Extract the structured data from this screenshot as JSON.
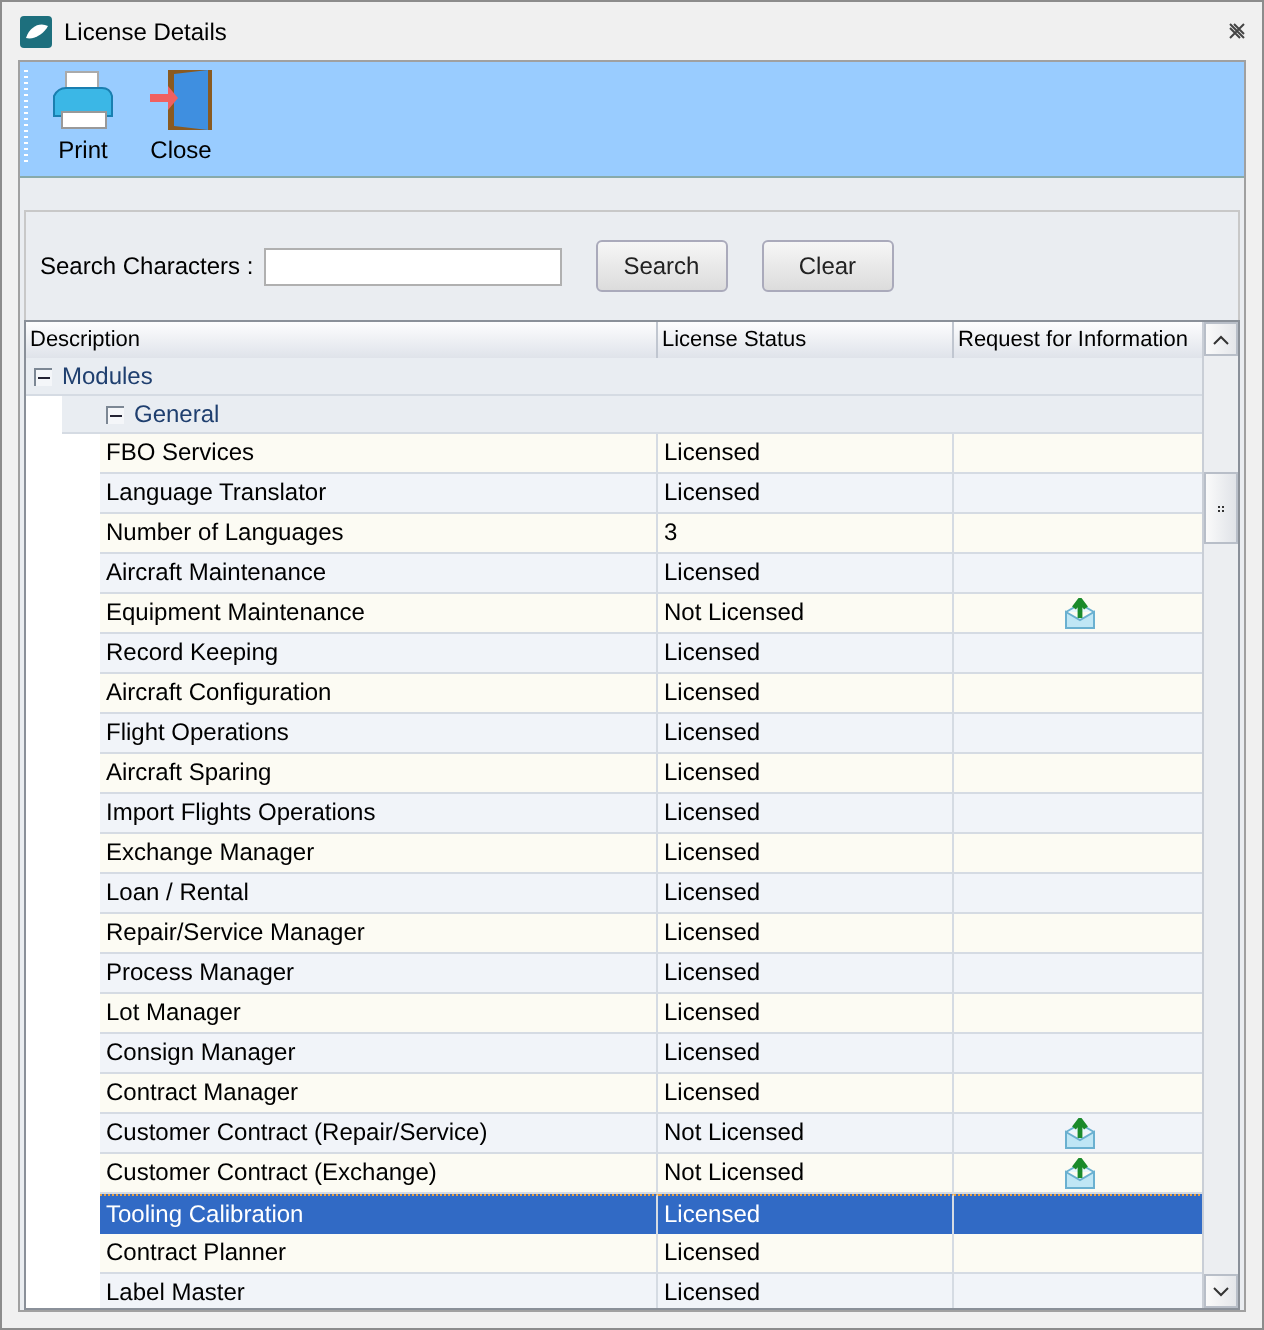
{
  "window": {
    "title": "License Details"
  },
  "toolbar": [
    {
      "label": "Print",
      "kind": "print"
    },
    {
      "label": "Close",
      "kind": "close"
    }
  ],
  "search": {
    "label": "Search Characters :",
    "buttons": [
      "Search",
      "Clear"
    ]
  },
  "grid": {
    "columns": [
      "Description",
      "License Status",
      "Request for Information"
    ],
    "groups": [
      {
        "label": "Modules",
        "expanded": true,
        "children": [
          {
            "label": "General",
            "expanded": true,
            "rows": [
              {
                "description": "FBO Services",
                "status": "Licensed",
                "request": false,
                "selected": false
              },
              {
                "description": "Language Translator",
                "status": "Licensed",
                "request": false,
                "selected": false
              },
              {
                "description": "Number of Languages",
                "status": "3",
                "request": false,
                "selected": false
              },
              {
                "description": "Aircraft Maintenance",
                "status": "Licensed",
                "request": false,
                "selected": false
              },
              {
                "description": "Equipment Maintenance",
                "status": "Not Licensed",
                "request": true,
                "selected": false
              },
              {
                "description": "Record Keeping",
                "status": "Licensed",
                "request": false,
                "selected": false
              },
              {
                "description": "Aircraft Configuration",
                "status": "Licensed",
                "request": false,
                "selected": false
              },
              {
                "description": "Flight Operations",
                "status": "Licensed",
                "request": false,
                "selected": false
              },
              {
                "description": "Aircraft Sparing",
                "status": "Licensed",
                "request": false,
                "selected": false
              },
              {
                "description": "Import Flights Operations",
                "status": "Licensed",
                "request": false,
                "selected": false
              },
              {
                "description": "Exchange Manager",
                "status": "Licensed",
                "request": false,
                "selected": false
              },
              {
                "description": "Loan / Rental",
                "status": "Licensed",
                "request": false,
                "selected": false
              },
              {
                "description": "Repair/Service Manager",
                "status": "Licensed",
                "request": false,
                "selected": false
              },
              {
                "description": "Process Manager",
                "status": "Licensed",
                "request": false,
                "selected": false
              },
              {
                "description": "Lot Manager",
                "status": "Licensed",
                "request": false,
                "selected": false
              },
              {
                "description": "Consign Manager",
                "status": "Licensed",
                "request": false,
                "selected": false
              },
              {
                "description": "Contract Manager",
                "status": "Licensed",
                "request": false,
                "selected": false
              },
              {
                "description": "Customer Contract (Repair/Service)",
                "status": "Not Licensed",
                "request": true,
                "selected": false
              },
              {
                "description": "Customer Contract (Exchange)",
                "status": "Not Licensed",
                "request": true,
                "selected": false
              },
              {
                "description": "Tooling Calibration",
                "status": "Licensed",
                "request": false,
                "selected": true
              },
              {
                "description": "Contract Planner",
                "status": "Licensed",
                "request": false,
                "selected": false
              },
              {
                "description": "Label Master",
                "status": "Licensed",
                "request": false,
                "selected": false
              }
            ]
          }
        ]
      }
    ]
  }
}
